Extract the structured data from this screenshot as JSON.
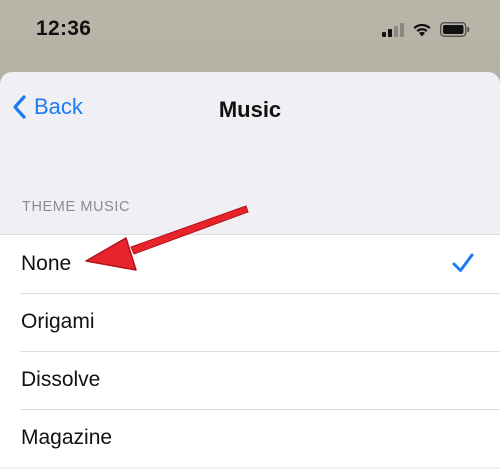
{
  "status_bar": {
    "time": "12:36",
    "icons": [
      "signal-icon",
      "wifi-icon",
      "battery-icon"
    ]
  },
  "nav": {
    "back_label": "Back",
    "title": "Music"
  },
  "section": {
    "header": "THEME MUSIC"
  },
  "options": [
    {
      "label": "None",
      "selected": true
    },
    {
      "label": "Origami",
      "selected": false
    },
    {
      "label": "Dissolve",
      "selected": false
    },
    {
      "label": "Magazine",
      "selected": false
    }
  ],
  "colors": {
    "accent": "#1d7bf4",
    "annotation_arrow": "#e8232b",
    "sheet_background": "#efeff4",
    "list_background": "#ffffff"
  }
}
